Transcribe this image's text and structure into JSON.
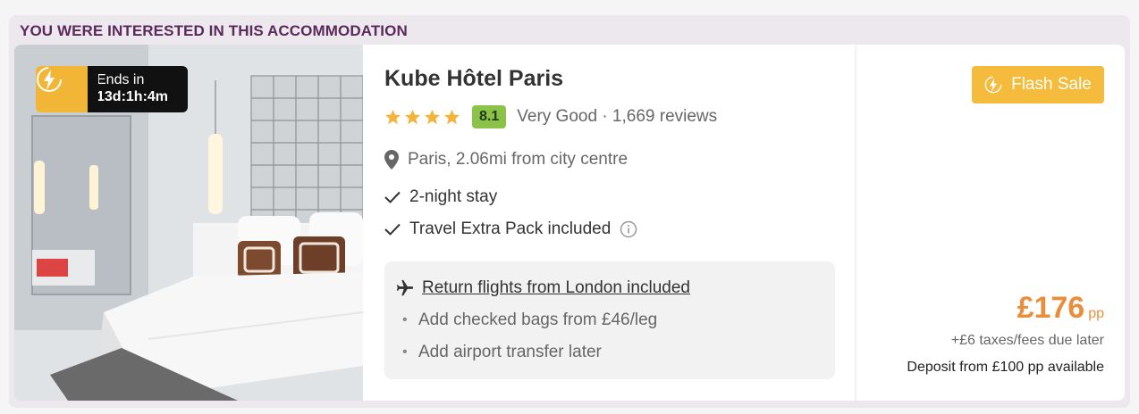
{
  "banner": {
    "text": "YOU WERE INTERESTED IN THIS ACCOMMODATION"
  },
  "timer": {
    "line1": "Ends in",
    "line2": "13d:1h:4m",
    "icon": "flash-bolt-icon"
  },
  "hotel": {
    "name": "Kube Hôtel Paris",
    "stars": 4,
    "score": "8.1",
    "rating_text": "Very Good · 1,669 reviews",
    "location": "Paris, 2.06mi from city centre"
  },
  "features": [
    {
      "label": "2-night stay",
      "icon": "check-icon"
    },
    {
      "label": "Travel Extra Pack included",
      "icon": "check-icon"
    }
  ],
  "flights": {
    "main": "Return flights from London included",
    "extras": [
      "Add checked bags from £46/leg",
      "Add airport transfer later"
    ]
  },
  "pricing": {
    "badge": "Flash Sale",
    "amount": "£176",
    "unit": "pp",
    "taxes": "+£6 taxes/fees due later",
    "deposit": "Deposit from £100 pp available"
  },
  "colors": {
    "banner_text": "#5a2a5a",
    "accent": "#f4bb3c",
    "price": "#e98f3b",
    "score_bg": "#8bc34a"
  }
}
